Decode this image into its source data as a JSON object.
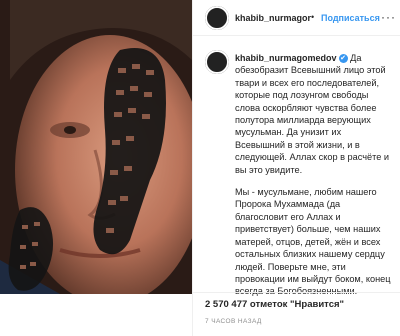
{
  "post": {
    "username": "khabib_nurmagor",
    "follow_label": "Подписаться",
    "separator": "•",
    "more_label": "···"
  },
  "caption": {
    "username": "khabib_nurmagomedov",
    "paragraph1": "Да обезобразит Всевышний лицо этой твари и всех его последователей, которые под лозунгом свободы слова оскорбляют чувства более полутора миллиарда верующих мусульман. Да унизит их Всевышний в этой жизни, и в следующей. Аллах скор в расчёте и вы это увидите.",
    "paragraph2": "Мы - мусульмане, любим нашего Пророка Мухаммада (да благословит его Аллах и приветствует) больше, чем наших матерей, отцов, детей, жён и всех остальных близких нашему сердцу людей. Поверьте мне, эти провокации им выйдут боком, конец всегда за Богобоязненными."
  },
  "likes": "2 570 477 отметок \"Нравится\"",
  "time": "7 ЧАСОВ НАЗАД",
  "colors": {
    "link": "#3897f0",
    "text": "#262626",
    "muted": "#8e8e8e"
  },
  "icons": {
    "verified": "✔"
  }
}
